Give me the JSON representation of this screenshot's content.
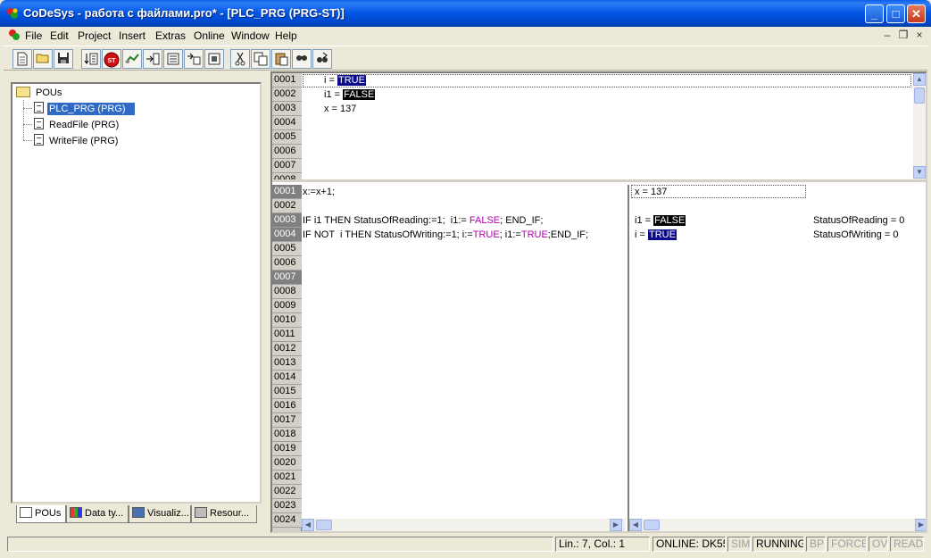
{
  "window": {
    "title": "CoDeSys - работа с файлами.pro* - [PLC_PRG (PRG-ST)]",
    "minimize_glyph": "_",
    "maximize_glyph": "□",
    "close_glyph": "✕"
  },
  "menu": {
    "items": [
      "File",
      "Edit",
      "Project",
      "Insert",
      "Extras",
      "Online",
      "Window",
      "Help"
    ],
    "mdi_minimize": "–",
    "mdi_restore": "❐",
    "mdi_close": "×"
  },
  "toolbar": {
    "buttons": [
      "new-icon",
      "open-icon",
      "save-icon",
      "build-icon",
      "stop-icon",
      "run-icon",
      "step-over-icon",
      "step-in-icon",
      "single-cycle-icon",
      "breakpoint-icon",
      "cut-icon",
      "copy-icon",
      "paste-icon",
      "find-icon",
      "find-next-icon"
    ],
    "stop_label": "ST"
  },
  "organizer": {
    "root": "POUs",
    "items": [
      "PLC_PRG (PRG)",
      "ReadFile (PRG)",
      "WriteFile (PRG)"
    ],
    "selected_index": 0,
    "tabs": [
      "POUs",
      "Data ty...",
      "Visualiz...",
      "Resour..."
    ]
  },
  "declaration": {
    "line_numbers": [
      "0001",
      "0002",
      "0003",
      "0004",
      "0005",
      "0006",
      "0007",
      "0008"
    ],
    "vars": [
      {
        "prefix": "i = ",
        "value": "TRUE",
        "style": "blue"
      },
      {
        "prefix": "i1 = ",
        "value": "FALSE",
        "style": "black"
      },
      {
        "prefix": "x = 137",
        "value": "",
        "style": "none"
      }
    ]
  },
  "body": {
    "line_numbers": [
      "0001",
      "0002",
      "0003",
      "0004",
      "0005",
      "0006",
      "0007",
      "0008",
      "0009",
      "0010",
      "0011",
      "0012",
      "0013",
      "0014",
      "0015",
      "0016",
      "0017",
      "0018",
      "0019",
      "0020",
      "0021",
      "0022",
      "0023",
      "0024"
    ],
    "breakpoint_lines": [
      0,
      2,
      3,
      6
    ],
    "line1": "x:=x+1;",
    "line3_a": "IF i1 THEN StatusOfReading:=1;  i1:= ",
    "line3_bool": "FALSE",
    "line3_b": "; END_IF;",
    "line4_a": "IF NOT  i THEN StatusOfWriting:=1; i:=",
    "line4_bool1": "TRUE",
    "line4_b": "; i1:=",
    "line4_bool2": "TRUE",
    "line4_c": ";END_IF;"
  },
  "monitor": {
    "line1": "x = 137",
    "line3_prefix": "i1 = ",
    "line3_value": "FALSE",
    "line3_right": "StatusOfReading = 0",
    "line4_prefix": "i = ",
    "line4_value": "TRUE",
    "line4_right": "StatusOfWriting = 0"
  },
  "status": {
    "position": "Lin.: 7, Col.: 1",
    "online": "ONLINE: DK55",
    "sim": "SIM",
    "running": "RUNNING",
    "bp": "BP",
    "force": "FORCE",
    "ov": "OV",
    "read": "READ"
  },
  "scroll": {
    "up": "▲",
    "down": "▼",
    "left": "◀",
    "right": "▶"
  }
}
